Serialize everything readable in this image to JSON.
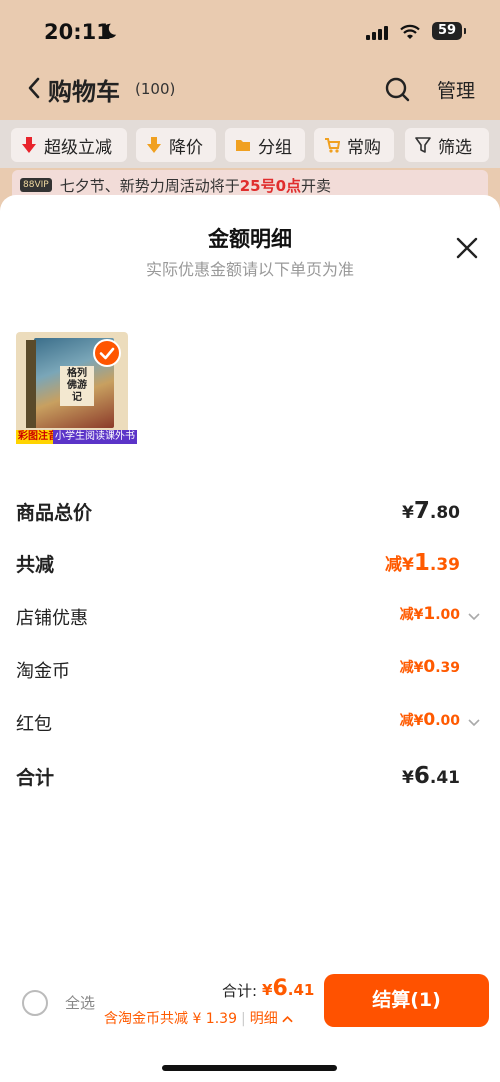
{
  "status_bar": {
    "time": "20:11",
    "battery": "59"
  },
  "nav": {
    "title": "购物车",
    "count": "(100)",
    "manage": "管理"
  },
  "filters": [
    {
      "label": "超级立减",
      "icon": "down-arrow-icon"
    },
    {
      "label": "降价",
      "icon": "price-drop-icon"
    },
    {
      "label": "分组",
      "icon": "folder-icon"
    },
    {
      "label": "常购",
      "icon": "cart-icon"
    },
    {
      "label": "筛选",
      "icon": "filter-icon"
    }
  ],
  "promo": {
    "badge": "88VIP",
    "text_before": "七夕节、新势力周活动将于",
    "highlight": "25号0点",
    "text_after": "开卖"
  },
  "sheet": {
    "title": "金额明细",
    "subtitle": "实际优惠金额请以下单页为准",
    "product": {
      "book_title": "格列佛游记",
      "tag_left": "彩图注音",
      "tag_right": "小学生阅读课外书"
    },
    "rows": [
      {
        "label": "商品总价",
        "prefix": "¥",
        "int": "7",
        "dec": ".80"
      },
      {
        "label": "共减",
        "prefix": "减¥",
        "int": "1",
        "dec": ".39"
      },
      {
        "label": "店铺优惠",
        "prefix": "减¥",
        "int": "1",
        "dec": ".00"
      },
      {
        "label": "淘金币",
        "prefix": "减¥",
        "int": "0",
        "dec": ".39"
      },
      {
        "label": "红包",
        "prefix": "减¥",
        "int": "0",
        "dec": ".00"
      },
      {
        "label": "合计",
        "prefix": "¥",
        "int": "6",
        "dec": ".41"
      }
    ]
  },
  "footer": {
    "select_all": "全选",
    "total_label": "合计:",
    "total_prefix": "¥",
    "total_int": "6",
    "total_dec": ".41",
    "detail_text": "含淘金币共减 ¥ 1.39",
    "detail_link": "明细",
    "pay_button": "结算(1)"
  },
  "colors": {
    "accent": "#ff5a00",
    "header_bg": "#e9cbb0"
  }
}
